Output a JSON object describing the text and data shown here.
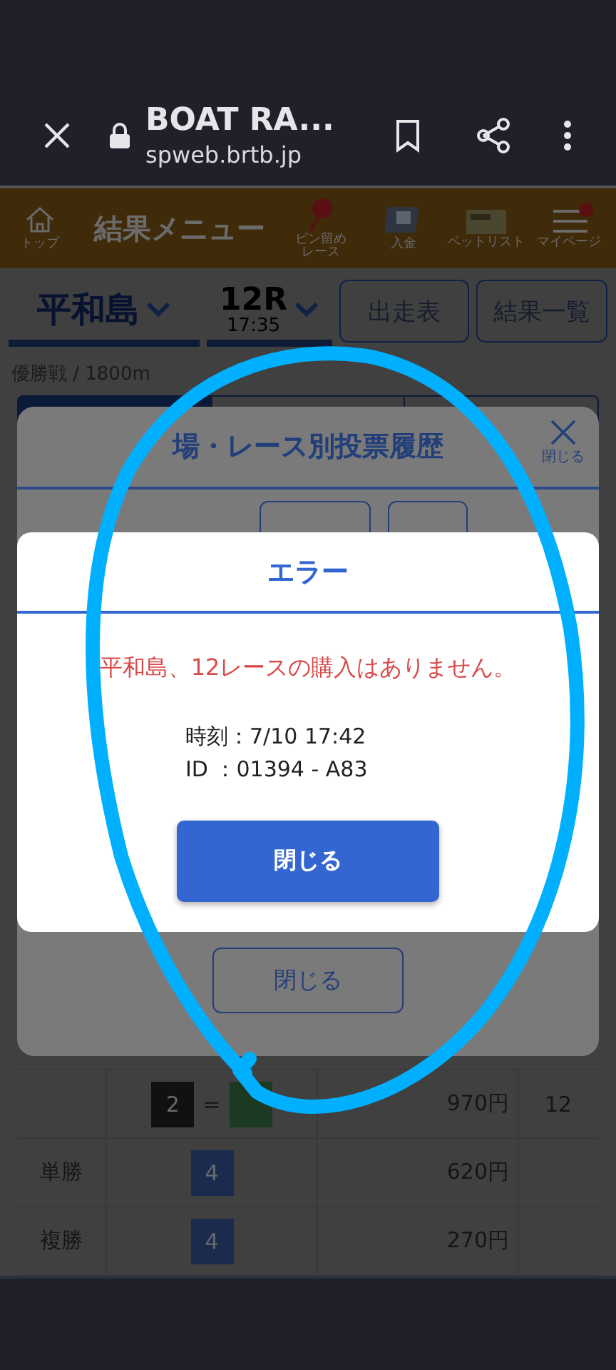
{
  "browser_bar": {
    "title": "BOAT RA...",
    "url": "spweb.brtb.jp"
  },
  "site_header": {
    "title": "結果メニュー",
    "home_label": "トップ",
    "items": [
      {
        "kind": "pin",
        "label": "ピン留めレース"
      },
      {
        "kind": "deposit",
        "label": "入金"
      },
      {
        "kind": "betlist",
        "label": "ベットリスト"
      },
      {
        "kind": "mypage",
        "label": "マイページ",
        "badge": true
      }
    ]
  },
  "race_selector": {
    "venue": "平和島",
    "race": "12R",
    "time": "17:35",
    "buttons": [
      "出走表",
      "結果一覧"
    ]
  },
  "race_info": "優勝戦 / 1800m",
  "tabs": [
    {
      "selected": true
    },
    {
      "selected": false
    },
    {
      "selected": false
    }
  ],
  "history_modal": {
    "title": "場・レース別投票履歴",
    "close_label": "閉じる",
    "close_button": "閉じる"
  },
  "error_dialog": {
    "title": "エラー",
    "message": "平和島、12レースの購入はありません。",
    "details": [
      "時刻：7/10 17:42",
      "ID ：01394 - A83"
    ],
    "button": "閉じる"
  },
  "results_table": {
    "rows": [
      {
        "boats": [
          {
            "label": "2",
            "color": "#111111"
          },
          {
            "color": "#1c3a22"
          }
        ],
        "separator": "=",
        "payout": "970円",
        "popularity": "12"
      },
      {
        "bet_type": "単勝",
        "boats": [
          {
            "label": "4",
            "color": "#1b2b4e"
          }
        ],
        "payout": "620円"
      },
      {
        "bet_type": "複勝",
        "boats": [
          {
            "label": "4",
            "color": "#1b2b4e"
          }
        ],
        "payout": "270円"
      }
    ]
  }
}
